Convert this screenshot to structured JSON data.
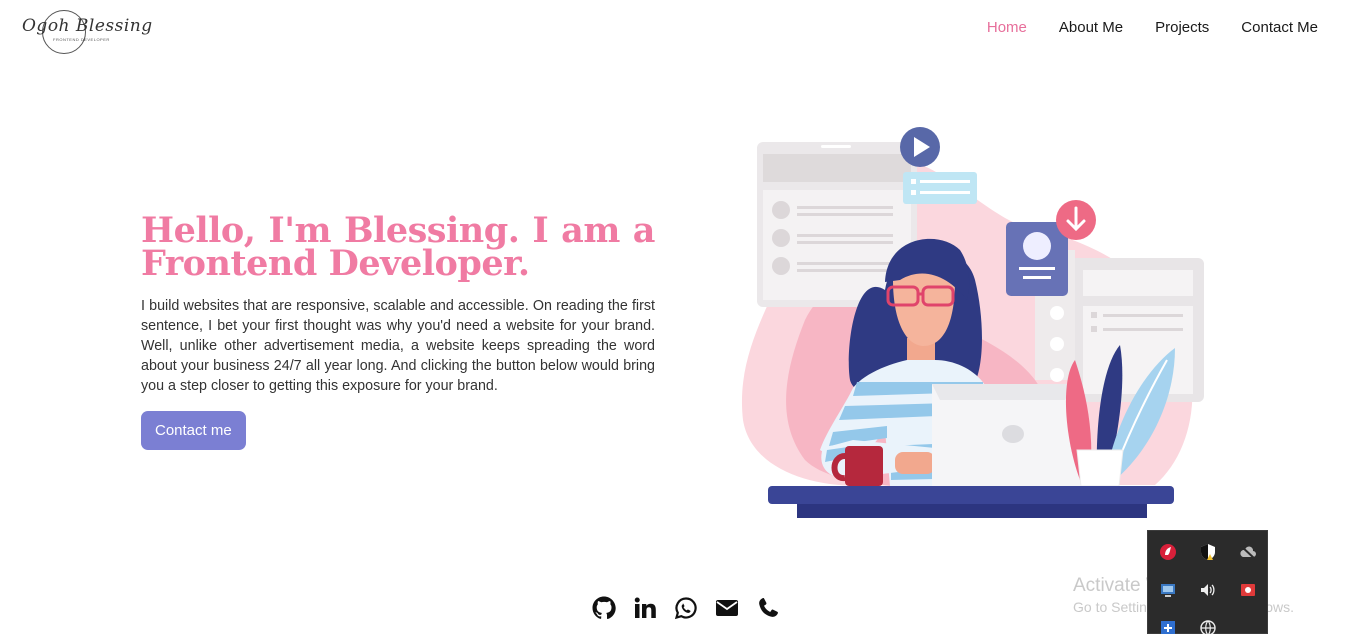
{
  "logo": {
    "script_text": "Ogoh Blessing",
    "tagline": "Frontend Developer"
  },
  "nav": {
    "home": "Home",
    "about": "About Me",
    "projects": "Projects",
    "contact": "Contact Me"
  },
  "hero": {
    "title": "Hello, I'm Blessing. I am a Frontend Developer.",
    "description": "I build websites that are responsive, scalable and accessible. On reading the first sentence, I bet your first thought was why you'd need a website for your brand. Well, unlike other advertisement media, a website keeps spreading the word about your business 24/7 all year long. And clicking the button below would bring you a step closer to getting this exposure for your brand.",
    "cta": "Contact me"
  },
  "socials": [
    "github-icon",
    "linkedin-icon",
    "whatsapp-icon",
    "email-icon",
    "phone-icon"
  ],
  "watermark": {
    "line1": "Activate Windows",
    "line2": "Go to Settings to activate Windows."
  },
  "tray": [
    "antivirus-icon",
    "security-shield-icon",
    "cloud-offline-icon",
    "network-display-icon",
    "volume-icon",
    "screen-record-icon",
    "add-icon",
    "globe-icon"
  ],
  "colors": {
    "accent_pink": "#f07ba3",
    "nav_active": "#e76f9b",
    "button": "#7b7fd3",
    "desk": "#3a4596"
  }
}
